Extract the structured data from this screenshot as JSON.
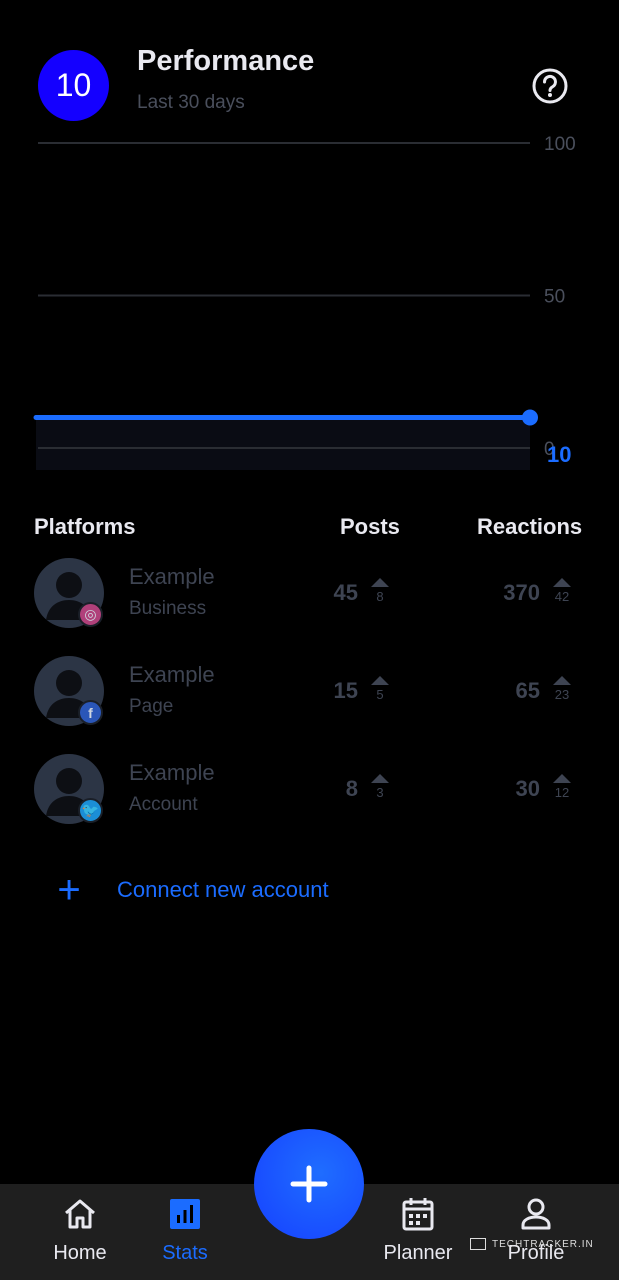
{
  "header": {
    "score": "10",
    "title": "Performance",
    "subtitle": "Last 30 days",
    "help_icon": "question-circle-icon"
  },
  "chart_data": {
    "type": "line",
    "ylim": [
      0,
      100
    ],
    "y_ticks": [
      "100",
      "50",
      "0"
    ],
    "x": [
      1,
      30
    ],
    "values": [
      10,
      10
    ],
    "end_label": "10",
    "grid": true,
    "color": "#1b6cff"
  },
  "table": {
    "headers": {
      "platforms": "Platforms",
      "posts": "Posts",
      "reactions": "Reactions"
    },
    "rows": [
      {
        "name": "Example",
        "type": "Business",
        "network": "instagram",
        "badge_glyph": "◎",
        "badge_color": "#b0407a",
        "posts": "45",
        "posts_delta": "8",
        "reactions": "370",
        "reactions_delta": "42"
      },
      {
        "name": "Example",
        "type": "Page",
        "network": "facebook",
        "badge_glyph": "f",
        "badge_color": "#2a56b8",
        "posts": "15",
        "posts_delta": "5",
        "reactions": "65",
        "reactions_delta": "23"
      },
      {
        "name": "Example",
        "type": "Account",
        "network": "twitter",
        "badge_glyph": "🐦",
        "badge_color": "#1b8ed6",
        "posts": "8",
        "posts_delta": "3",
        "reactions": "30",
        "reactions_delta": "12"
      }
    ]
  },
  "connect": {
    "label": "Connect new account"
  },
  "nav": {
    "items": [
      {
        "label": "Home",
        "icon": "home-icon"
      },
      {
        "label": "Stats",
        "icon": "bar-chart-icon"
      },
      {
        "label": "Planner",
        "icon": "calendar-icon"
      },
      {
        "label": "Profile",
        "icon": "person-icon"
      }
    ],
    "active": "Stats"
  },
  "watermark": "TECHTRACKER.IN"
}
